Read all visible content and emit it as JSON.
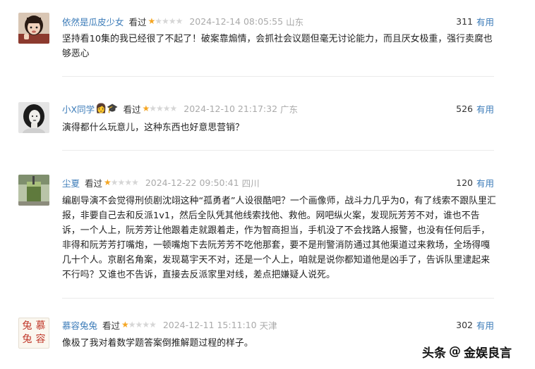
{
  "reviews": [
    {
      "user": "依然是瓜皮少女",
      "watched": "看过",
      "stars_filled": 1,
      "stars_total": 5,
      "time": "2024-12-14 08:05:55",
      "location": "山东",
      "useful_count": "311",
      "useful_label": "有用",
      "content": "坚持看10集的我已经很了不起了！破案靠煽情，会抓社会议题但毫无讨论能力，而且厌女极重，强行卖腐也够恶心"
    },
    {
      "user": "小X同学",
      "badge_emoji": "👩🎓",
      "watched": "看过",
      "stars_filled": 1,
      "stars_total": 5,
      "time": "2024-12-10 21:17:32",
      "location": "广东",
      "useful_count": "526",
      "useful_label": "有用",
      "content": "演得都什么玩意儿，这种东西也好意思营销？"
    },
    {
      "user": "尘夏",
      "watched": "看过",
      "stars_filled": 1,
      "stars_total": 5,
      "time": "2024-12-22 09:50:41",
      "location": "四川",
      "useful_count": "120",
      "useful_label": "有用",
      "content": "编剧导演不会觉得刑侦剧沈翊这种“孤勇者”人设很酷吧？一个画像师，战斗力几乎为0，有了线索不跟队里汇报，非要自己去和反派1v1，然后全队凭其他线索找他、救他。网吧纵火案，发现阮芳芳不对，谁也不告诉，一个人上，阮芳芳让他跟着走就跟着走，作为智商担当，手机没了不会找路人报警，也没有任何后手，非得和阮芳芳打嘴炮，一顿嘴炮下去阮芳芳不吃他那套，要不是刑警消防通过其他渠道过来救场，全场得嘎几十个人。京剧名角案，发现葛宇天不对，还是一个人上，咱就是说你都知道他是凶手了，告诉队里逮起来不行吗？又谁也不告诉，直接去反派家里对线，差点把嫌疑人说死。"
    },
    {
      "user": "慕容兔兔",
      "watched": "看过",
      "stars_filled": 1,
      "stars_total": 5,
      "time": "2024-12-11 15:11:10",
      "location": "天津",
      "useful_count": "302",
      "useful_label": "有用",
      "content": "像极了我对着数学题答案倒推解题过程的样子。",
      "avatar_seal_text": [
        "兔",
        "慕",
        "兔",
        "容"
      ]
    }
  ],
  "watermark": {
    "platform": "头条",
    "separator": "@",
    "account": "金娱良言"
  },
  "colors": {
    "link": "#3b7bb8",
    "star_on": "#f5a623",
    "star_off": "#d6d6d6",
    "meta_gray": "#aaaaaa",
    "seal_red": "#c0392b"
  }
}
